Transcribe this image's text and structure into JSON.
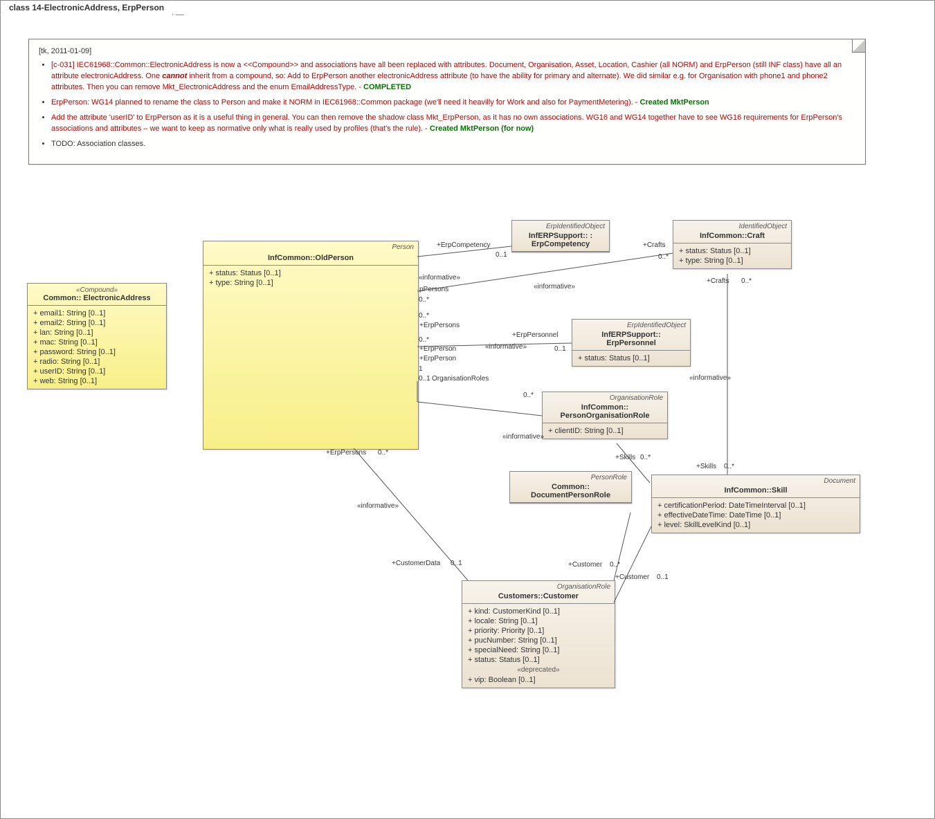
{
  "title": "class 14-ElectronicAddress, ErpPerson",
  "note": {
    "header": "[tk, 2011-01-09]",
    "bullets": [
      {
        "red": "[c-031] IEC61968::Common::ElectronicAddress is now a <<Compound>> and associations have all been replaced with attributes. Document, Organisation, Asset, Location, Cashier (all NORM) and ErpPerson (still INF class) have all an attribute electronicAddress. One ",
        "bold": "cannot",
        "red2": " inherit from a compound, so: Add to ErpPerson another electronicAddress attribute (to have the ability for primary and alternate). We did similar e.g. for Organisation with phone1 and phone2 attributes. Then you can remove Mkt_ElectronicAddress and the enum EmailAddressType. - ",
        "green": "COMPLETED"
      },
      {
        "red": "ErpPerson: WG14 planned to rename the class to Person and make it NORM in IEC61968::Common package (we'll need it heavilly for Work and also for PaymentMetering). - ",
        "green": "Created MktPerson"
      },
      {
        "red": "Add the attribute 'userID' to ErpPerson as it is a useful thing in general. You can then remove the shadow class Mkt_ErpPerson, as it has no own associations. WG16 and WG14 together have to see WG16 requirements for ErpPerson's associations and attributes – we want to keep as normative only what is really used by profiles (that's the rule). - ",
        "green": "Created MktPerson (for now)"
      },
      {
        "plain": "TODO: Association classes."
      }
    ]
  },
  "classes": {
    "electronicAddress": {
      "stereotype": "«Compound»",
      "name": "Common:: ElectronicAddress",
      "attrs": [
        "email1: String [0..1]",
        "email2: String [0..1]",
        "lan: String [0..1]",
        "mac: String [0..1]",
        "password: String [0..1]",
        "radio: String [0..1]",
        "userID: String [0..1]",
        "web: String [0..1]"
      ]
    },
    "oldPerson": {
      "parent": "Person",
      "name": "InfCommon::OldPerson",
      "attrs": [
        "status: Status [0..1]",
        "type: String [0..1]"
      ]
    },
    "erpCompetency": {
      "parent": "ErpIdentifiedObject",
      "name": "InfERPSupport::  :  ErpCompetency"
    },
    "craft": {
      "parent": "IdentifiedObject",
      "name": "InfCommon::Craft",
      "attrs": [
        "status: Status [0..1]",
        "type: String [0..1]"
      ]
    },
    "erpPersonnel": {
      "parent": "ErpIdentifiedObject",
      "name": "InfERPSupport:: ErpPersonnel",
      "attrs": [
        "status: Status [0..1]"
      ]
    },
    "personOrgRole": {
      "parent": "OrganisationRole",
      "name": "InfCommon:: PersonOrganisationRole",
      "attrs": [
        "clientID: String [0..1]"
      ]
    },
    "docPersonRole": {
      "parent": "PersonRole",
      "name": "Common:: DocumentPersonRole"
    },
    "skill": {
      "parent": "Document",
      "name": "InfCommon::Skill",
      "attrs": [
        "certificationPeriod: DateTimeInterval [0..1]",
        "effectiveDateTime: DateTime [0..1]",
        "level: SkillLevelKind [0..1]"
      ]
    },
    "customer": {
      "parent": "OrganisationRole",
      "name": "Customers::Customer",
      "attrs": [
        "kind: CustomerKind [0..1]",
        "locale: String [0..1]",
        "priority: Priority [0..1]",
        "pucNumber: String [0..1]",
        "specialNeed: String [0..1]",
        "status: Status [0..1]"
      ],
      "depSection": "«deprecated»",
      "depAttrs": [
        "vip: Boolean [0..1]"
      ]
    }
  },
  "labels": {
    "erpCompetency": "+ErpCompetency",
    "erpCompetencyMult": "0..1",
    "crafts": "+Crafts",
    "craftsMult": "0..*",
    "pPersons": "pPersons",
    "erpPersons": "+ErpPersons",
    "erpPerson": "+ErpPerson",
    "erpPersonnel": "+ErpPersonnel",
    "erpPersonnelMult": "0..1",
    "orgRoles": "OrganisationRoles",
    "orgRolesMult": "0..*",
    "informative": "«informative»",
    "skills": "+Skills",
    "skillsMult": "0..*",
    "customerData": "+CustomerData",
    "customerDataMult": "0..1",
    "customer": "+Customer",
    "customerMult1": "0..*",
    "customerMult2": "0..1",
    "mult0s": "0..*",
    "mult1": "1",
    "mult01": "0..1"
  }
}
